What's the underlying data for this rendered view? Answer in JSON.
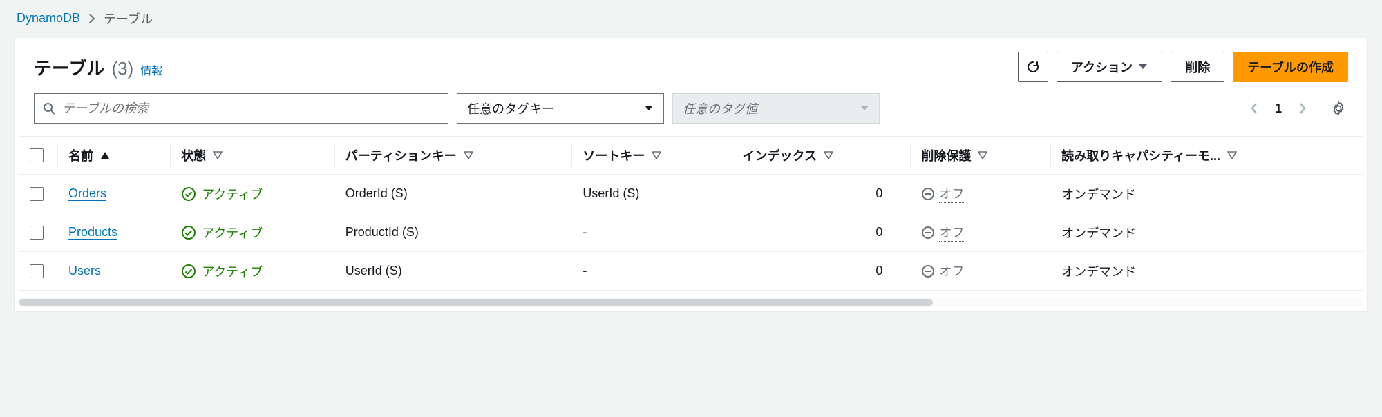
{
  "breadcrumb": {
    "root": "DynamoDB",
    "current": "テーブル"
  },
  "header": {
    "title": "テーブル",
    "count": "(3)",
    "info": "情報",
    "actions_label": "アクション",
    "delete_label": "削除",
    "create_label": "テーブルの作成"
  },
  "filters": {
    "search_placeholder": "テーブルの検索",
    "tag_key_label": "任意のタグキー",
    "tag_value_label": "任意のタグ値",
    "page": "1"
  },
  "columns": {
    "name": "名前",
    "status": "状態",
    "partition_key": "パーティションキー",
    "sort_key": "ソートキー",
    "indexes": "インデックス",
    "deletion_protection": "削除保護",
    "read_capacity_mode": "読み取りキャパシティーモ..."
  },
  "rows": [
    {
      "name": "Orders",
      "status": "アクティブ",
      "partition_key": "OrderId (S)",
      "sort_key": "UserId (S)",
      "indexes": "0",
      "protection": "オフ",
      "read_mode": "オンデマンド"
    },
    {
      "name": "Products",
      "status": "アクティブ",
      "partition_key": "ProductId (S)",
      "sort_key": "-",
      "indexes": "0",
      "protection": "オフ",
      "read_mode": "オンデマンド"
    },
    {
      "name": "Users",
      "status": "アクティブ",
      "partition_key": "UserId (S)",
      "sort_key": "-",
      "indexes": "0",
      "protection": "オフ",
      "read_mode": "オンデマンド"
    }
  ]
}
